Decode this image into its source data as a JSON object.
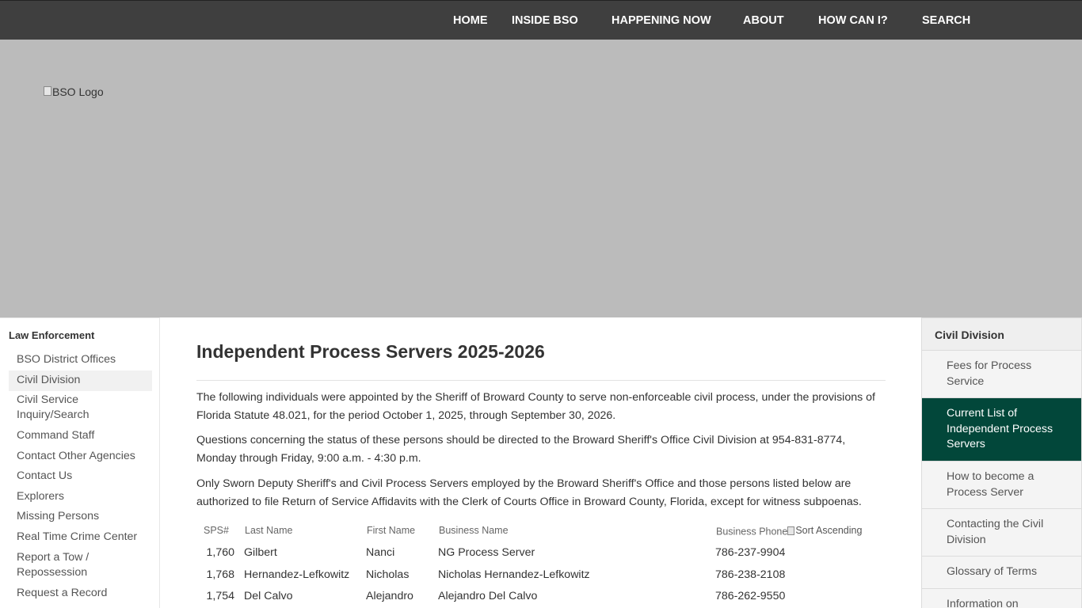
{
  "nav": {
    "items": [
      {
        "label": "HOME"
      },
      {
        "label": "INSIDE BSO"
      },
      {
        "label": "HAPPENING NOW"
      },
      {
        "label": "ABOUT"
      },
      {
        "label": "HOW CAN I?"
      },
      {
        "label": "SEARCH"
      }
    ]
  },
  "hero": {
    "logo_alt": "BSO Logo"
  },
  "left_sidebar": {
    "heading": "Law Enforcement",
    "items": [
      {
        "label": "BSO District Offices"
      },
      {
        "label": "Civil Division",
        "active": true
      },
      {
        "label": "Civil Service Inquiry/Search"
      },
      {
        "label": "Command Staff"
      },
      {
        "label": "Contact Other Agencies"
      },
      {
        "label": "Contact Us"
      },
      {
        "label": "Explorers"
      },
      {
        "label": "Missing Persons"
      },
      {
        "label": "Real Time Crime Center"
      },
      {
        "label": "Report a Tow / Repossession"
      },
      {
        "label": "Request a Record"
      }
    ]
  },
  "main": {
    "title": "Independent Process Servers 2025-2026",
    "paragraphs": [
      "The following individuals were appointed by the Sheriff of Broward County to serve non-enforceable civil process, under the provisions of Florida Statute 48.021, for the period October 1, 2025, through September 30, 2026.",
      "Questions concerning the status of these persons should be directed to the Broward Sheriff's Office Civil Division at 954-831-8774, Monday through Friday, 9:00 a.m. - 4:30 p.m.",
      "Only Sworn Deputy Sheriff's and Civil Process Servers employed by the Broward Sheriff's Office and those persons listed below are authorized to file Return of Service Affidavits with the Clerk of Courts Office in Broward County, Florida, except for witness subpoenas."
    ]
  },
  "table": {
    "headers": {
      "sps": "SPS#",
      "last": "Last Name",
      "first": "First Name",
      "business": "Business Name",
      "phone": "Business Phone",
      "sort_alt": "Sort Ascending"
    },
    "rows": [
      {
        "sps": "1,760",
        "last": "Gilbert",
        "first": "Nanci",
        "business": "NG Process Server",
        "phone": "786-237-9904"
      },
      {
        "sps": "1,768",
        "last": "Hernandez-Lefkowitz",
        "first": "Nicholas",
        "business": "Nicholas Hernandez-Lefkowitz",
        "phone": "786-238-2108"
      },
      {
        "sps": "1,754",
        "last": "Del Calvo",
        "first": "Alejandro",
        "business": "Alejandro Del Calvo",
        "phone": "786-262-9550"
      }
    ]
  },
  "right_sidebar": {
    "title": "Civil Division",
    "links": [
      {
        "label": "Fees for Process Service"
      },
      {
        "label": "Current List of Independent Process Servers",
        "active": true
      },
      {
        "label": "How to become a Process Server"
      },
      {
        "label": "Contacting the Civil Division"
      },
      {
        "label": "Glossary of Terms"
      },
      {
        "label": "Information on"
      }
    ]
  }
}
